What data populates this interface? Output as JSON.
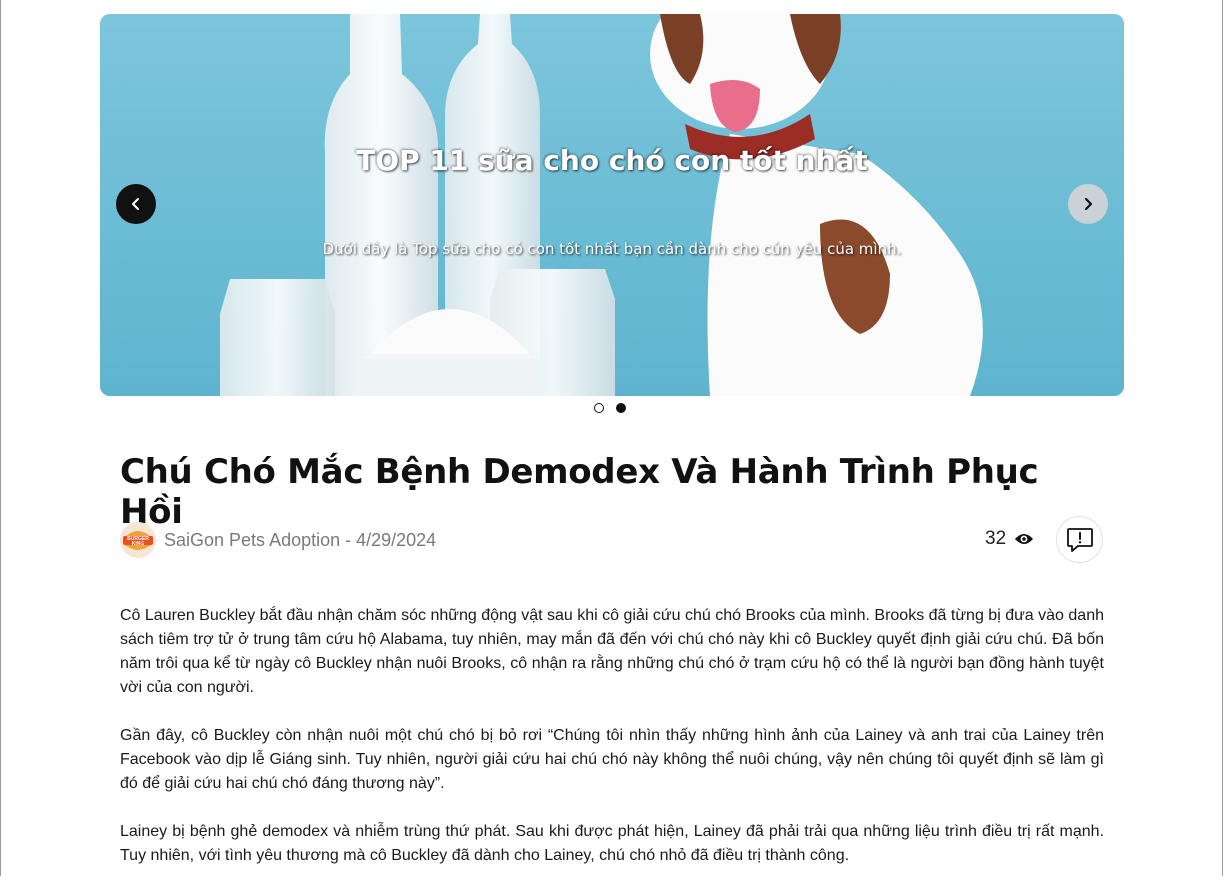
{
  "carousel": {
    "slide_title": "TOP 11 sữa cho chó con tốt nhất",
    "slide_subtitle": "Dưới đây là Top sữa cho có con tốt nhất bạn cần dành cho cún yêu của mình.",
    "prev_icon": "chevron-left-icon",
    "next_icon": "chevron-right-icon",
    "slide_count": 2,
    "active_index": 1
  },
  "post": {
    "title": "Chú Chó Mắc Bệnh Demodex Và Hành Trình Phục Hồi",
    "avatar_text_top": "BURGER",
    "avatar_text_bottom": "KING",
    "author_date": "SaiGon Pets Adoption - 4/29/2024",
    "views": "32",
    "views_icon": "eye-icon",
    "report_icon": "report-icon",
    "paragraphs": [
      "Cô Lauren Buckley bắt đầu nhận chăm sóc những động vật sau khi cô giải cứu chú chó Brooks của mình. Brooks đã từng bị đưa vào danh sách tiêm trợ tử ở trung tâm cứu hộ Alabama, tuy nhiên, may mắn đã đến với chú chó này khi cô Buckley quyết định giải cứu chú. Đã bốn năm trôi qua kể từ ngày cô Buckley nhận nuôi Brooks, cô nhận ra rằng những chú chó ở trạm cứu hộ có thể là người bạn đồng hành tuyệt vời của con người.",
      "Gần đây, cô Buckley còn nhận nuôi một chú chó bị bỏ rơi “Chúng tôi nhìn thấy những hình ảnh của Lainey và anh trai của Lainey trên Facebook vào dịp lễ Giáng sinh. Tuy nhiên, người giải cứu hai chú chó này không thể nuôi chúng, vậy nên chúng tôi quyết định sẽ làm gì đó để giải cứu hai chú chó đáng thương này”.",
      "Lainey bị bệnh ghẻ demodex và nhiễm trùng thứ phát. Sau khi được phát hiện, Lainey đã phải trải qua những liệu trình điều trị rất mạnh. Tuy nhiên, với tình yêu thương mà cô Buckley đã dành cho Lainey, chú chó nhỏ đã điều trị thành công."
    ]
  },
  "colors": {
    "slide_bg": "#6fc0d8",
    "avatar_orange": "#e8501e"
  }
}
